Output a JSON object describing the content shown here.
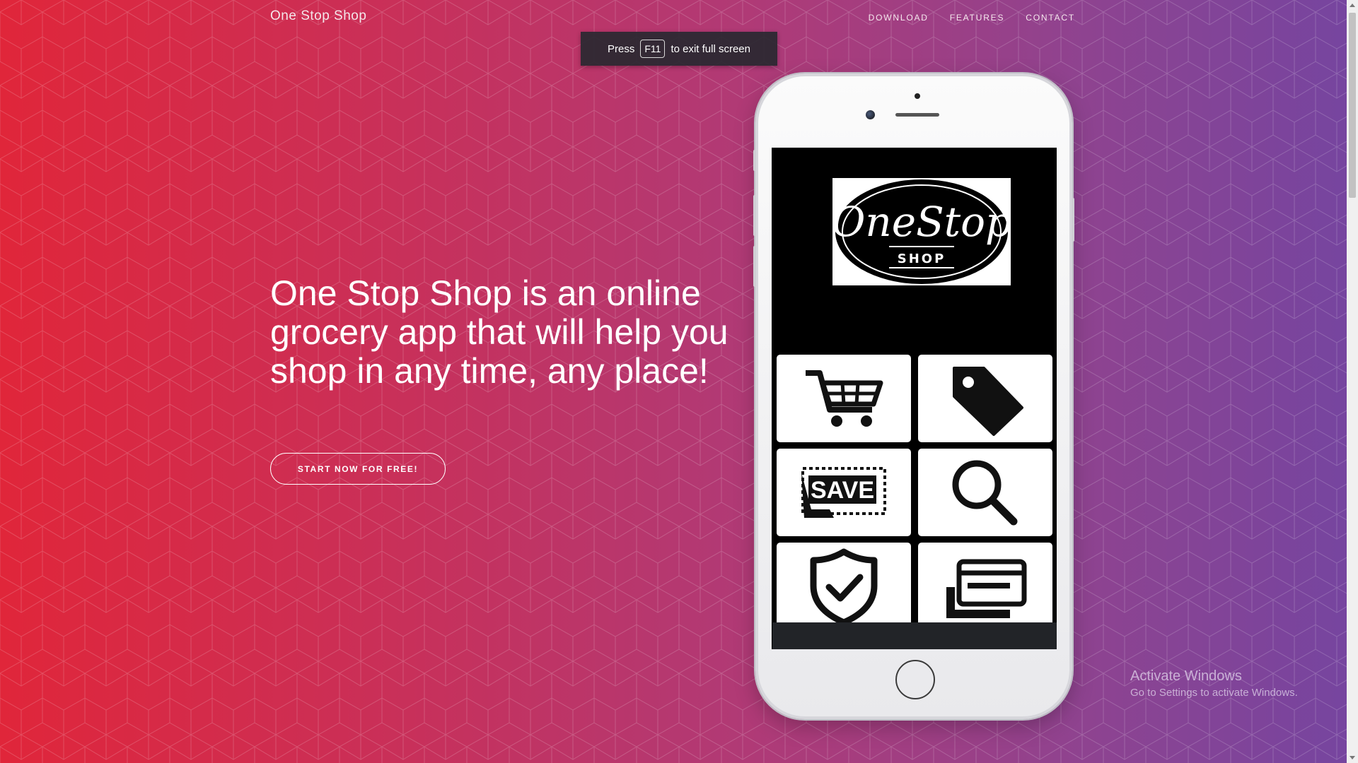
{
  "brand": "One Stop Shop",
  "nav": {
    "download": "DOWNLOAD",
    "features": "FEATURES",
    "contact": "CONTACT"
  },
  "fullscreen_toast": {
    "press": "Press",
    "key": "F11",
    "suffix": "to exit full screen"
  },
  "hero": {
    "heading": "One Stop Shop is an online grocery app that will help you shop in any time, any place!",
    "cta": "START NOW FOR FREE!"
  },
  "phone": {
    "logo_line1": "OneStop",
    "logo_line2": "SHOP",
    "tiles": [
      {
        "icon": "shopping-cart-icon"
      },
      {
        "icon": "price-tag-icon"
      },
      {
        "icon": "save-coupon-icon",
        "label": "SAVE"
      },
      {
        "icon": "magnifier-search-icon"
      },
      {
        "icon": "shield-check-icon"
      },
      {
        "icon": "credit-card-icon"
      }
    ]
  },
  "watermark": {
    "title": "Activate Windows",
    "subtitle": "Go to Settings to activate Windows."
  },
  "colors": {
    "gradient_left": "#e0263a",
    "gradient_right": "#7545a0",
    "screen": "#000000",
    "tile": "#ffffff"
  }
}
